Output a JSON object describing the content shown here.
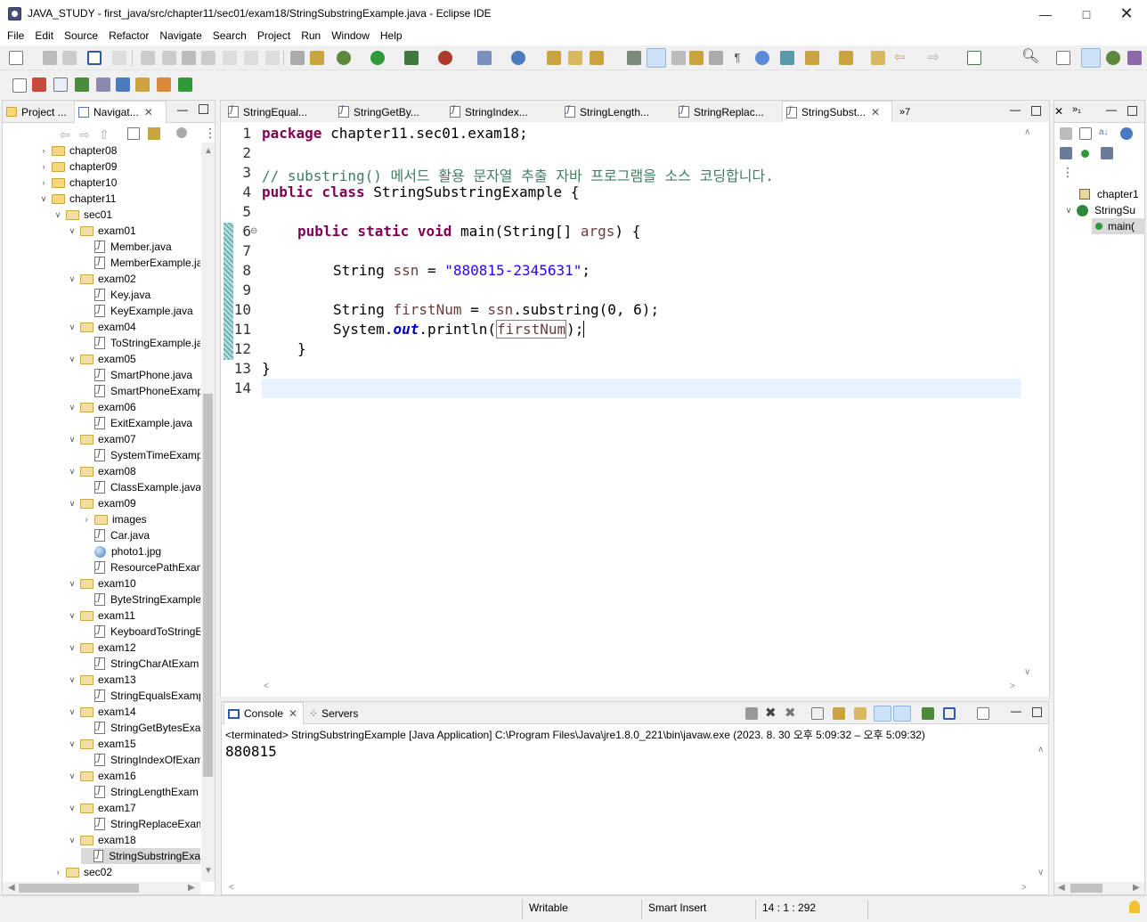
{
  "window": {
    "title": "JAVA_STUDY - first_java/src/chapter11/sec01/exam18/StringSubstringExample.java - Eclipse IDE"
  },
  "menu": [
    "File",
    "Edit",
    "Source",
    "Refactor",
    "Navigate",
    "Search",
    "Project",
    "Run",
    "Window",
    "Help"
  ],
  "left_panel": {
    "tabs": [
      {
        "label": "Project ..."
      },
      {
        "label": "Navigat..."
      }
    ],
    "tree": [
      {
        "label": "chapter08",
        "depth": 0,
        "kind": "folder",
        "open": false
      },
      {
        "label": "chapter09",
        "depth": 0,
        "kind": "folder",
        "open": false
      },
      {
        "label": "chapter10",
        "depth": 0,
        "kind": "folder",
        "open": false
      },
      {
        "label": "chapter11",
        "depth": 0,
        "kind": "folder",
        "open": true
      },
      {
        "label": "sec01",
        "depth": 1,
        "kind": "folder",
        "open": true
      },
      {
        "label": "exam01",
        "depth": 2,
        "kind": "folder",
        "open": true
      },
      {
        "label": "Member.java",
        "depth": 3,
        "kind": "java"
      },
      {
        "label": "MemberExample.ja",
        "depth": 3,
        "kind": "java"
      },
      {
        "label": "exam02",
        "depth": 2,
        "kind": "folder",
        "open": true
      },
      {
        "label": "Key.java",
        "depth": 3,
        "kind": "java"
      },
      {
        "label": "KeyExample.java",
        "depth": 3,
        "kind": "java"
      },
      {
        "label": "exam04",
        "depth": 2,
        "kind": "folder",
        "open": true
      },
      {
        "label": "ToStringExample.ja",
        "depth": 3,
        "kind": "java"
      },
      {
        "label": "exam05",
        "depth": 2,
        "kind": "folder",
        "open": true
      },
      {
        "label": "SmartPhone.java",
        "depth": 3,
        "kind": "java"
      },
      {
        "label": "SmartPhoneExamp",
        "depth": 3,
        "kind": "java"
      },
      {
        "label": "exam06",
        "depth": 2,
        "kind": "folder",
        "open": true
      },
      {
        "label": "ExitExample.java",
        "depth": 3,
        "kind": "java"
      },
      {
        "label": "exam07",
        "depth": 2,
        "kind": "folder",
        "open": true
      },
      {
        "label": "SystemTimeExamp",
        "depth": 3,
        "kind": "java"
      },
      {
        "label": "exam08",
        "depth": 2,
        "kind": "folder",
        "open": true
      },
      {
        "label": "ClassExample.java",
        "depth": 3,
        "kind": "java"
      },
      {
        "label": "exam09",
        "depth": 2,
        "kind": "folder",
        "open": true
      },
      {
        "label": "images",
        "depth": 3,
        "kind": "folder",
        "open": false
      },
      {
        "label": "Car.java",
        "depth": 3,
        "kind": "java"
      },
      {
        "label": "photo1.jpg",
        "depth": 3,
        "kind": "image"
      },
      {
        "label": "ResourcePathExam",
        "depth": 3,
        "kind": "java"
      },
      {
        "label": "exam10",
        "depth": 2,
        "kind": "folder",
        "open": true
      },
      {
        "label": "ByteStringExample",
        "depth": 3,
        "kind": "java"
      },
      {
        "label": "exam11",
        "depth": 2,
        "kind": "folder",
        "open": true
      },
      {
        "label": "KeyboardToStringE",
        "depth": 3,
        "kind": "java"
      },
      {
        "label": "exam12",
        "depth": 2,
        "kind": "folder",
        "open": true
      },
      {
        "label": "StringCharAtExam",
        "depth": 3,
        "kind": "java"
      },
      {
        "label": "exam13",
        "depth": 2,
        "kind": "folder",
        "open": true
      },
      {
        "label": "StringEqualsExamp",
        "depth": 3,
        "kind": "java"
      },
      {
        "label": "exam14",
        "depth": 2,
        "kind": "folder",
        "open": true
      },
      {
        "label": "StringGetBytesExar",
        "depth": 3,
        "kind": "java"
      },
      {
        "label": "exam15",
        "depth": 2,
        "kind": "folder",
        "open": true
      },
      {
        "label": "StringIndexOfExam",
        "depth": 3,
        "kind": "java"
      },
      {
        "label": "exam16",
        "depth": 2,
        "kind": "folder",
        "open": true
      },
      {
        "label": "StringLengthExam",
        "depth": 3,
        "kind": "java"
      },
      {
        "label": "exam17",
        "depth": 2,
        "kind": "folder",
        "open": true
      },
      {
        "label": "StringReplaceExam",
        "depth": 3,
        "kind": "java"
      },
      {
        "label": "exam18",
        "depth": 2,
        "kind": "folder",
        "open": true
      },
      {
        "label": "StringSubstringExa",
        "depth": 3,
        "kind": "java",
        "selected": true
      },
      {
        "label": "sec02",
        "depth": 1,
        "kind": "folder",
        "open": false
      }
    ]
  },
  "editor": {
    "tabs": [
      {
        "label": "StringEqual..."
      },
      {
        "label": "StringGetBy..."
      },
      {
        "label": "StringIndex..."
      },
      {
        "label": "StringLength..."
      },
      {
        "label": "StringReplac..."
      },
      {
        "label": "StringSubst...",
        "active": true
      }
    ],
    "overflow_count": "»7",
    "lines": [
      {
        "n": "1",
        "text": "package chapter11.sec01.exam18;"
      },
      {
        "n": "2",
        "text": ""
      },
      {
        "n": "3",
        "text": "// substring() 메서드 활용 문자열 추출 자바 프로그램을 소스 코딩합니다."
      },
      {
        "n": "4",
        "text": "public class StringSubstringExample {"
      },
      {
        "n": "5",
        "text": ""
      },
      {
        "n": "6",
        "text": "    public static void main(String[] args) {"
      },
      {
        "n": "7",
        "text": ""
      },
      {
        "n": "8",
        "text": "        String ssn = \"880815-2345631\";"
      },
      {
        "n": "9",
        "text": ""
      },
      {
        "n": "10",
        "text": "        String firstNum = ssn.substring(0, 6);"
      },
      {
        "n": "11",
        "text": "        System.out.println(firstNum);"
      },
      {
        "n": "12",
        "text": "    }"
      },
      {
        "n": "13",
        "text": "}"
      },
      {
        "n": "14",
        "text": ""
      }
    ],
    "code_parts": {
      "l1_kw": "package",
      "l1_rest": " chapter11.sec01.exam18;",
      "l3": "// substring() 메서드 활용 문자열 추출 자바 프로그램을 소스 코딩합니다.",
      "l4_kw": "public class",
      "l4_rest": " StringSubstringExample {",
      "l6_kw": "public static void",
      "l6_a": " main(String[] ",
      "l6_var": "args",
      "l6_b": ") {",
      "l8_a": "String ",
      "l8_var": "ssn",
      "l8_b": " = ",
      "l8_str": "\"880815-2345631\"",
      "l8_c": ";",
      "l10_a": "String ",
      "l10_var": "firstNum",
      "l10_b": " = ",
      "l10_var2": "ssn",
      "l10_c": ".substring(0, 6);",
      "l11_a": "System.",
      "l11_fld": "out",
      "l11_b": ".println(",
      "l11_var": "firstNum",
      "l11_c": ");",
      "l12": "}",
      "l13": "}"
    }
  },
  "outline": {
    "items": [
      {
        "label": "chapter1"
      },
      {
        "label": "StringSu"
      },
      {
        "label": "main("
      }
    ]
  },
  "console": {
    "tabs": [
      {
        "label": "Console"
      },
      {
        "label": "Servers"
      }
    ],
    "status": "<terminated> StringSubstringExample [Java Application] C:\\Program Files\\Java\\jre1.8.0_221\\bin\\javaw.exe  (2023. 8. 30 오후 5:09:32 – 오후 5:09:32)",
    "output": "880815"
  },
  "statusbar": {
    "writable": "Writable",
    "insert_mode": "Smart Insert",
    "position": "14 : 1 : 292"
  },
  "colors": {
    "keyword": "#7f0055",
    "string": "#2a00ff",
    "comment": "#3f7f5f",
    "current_line": "#e8f2fe"
  }
}
